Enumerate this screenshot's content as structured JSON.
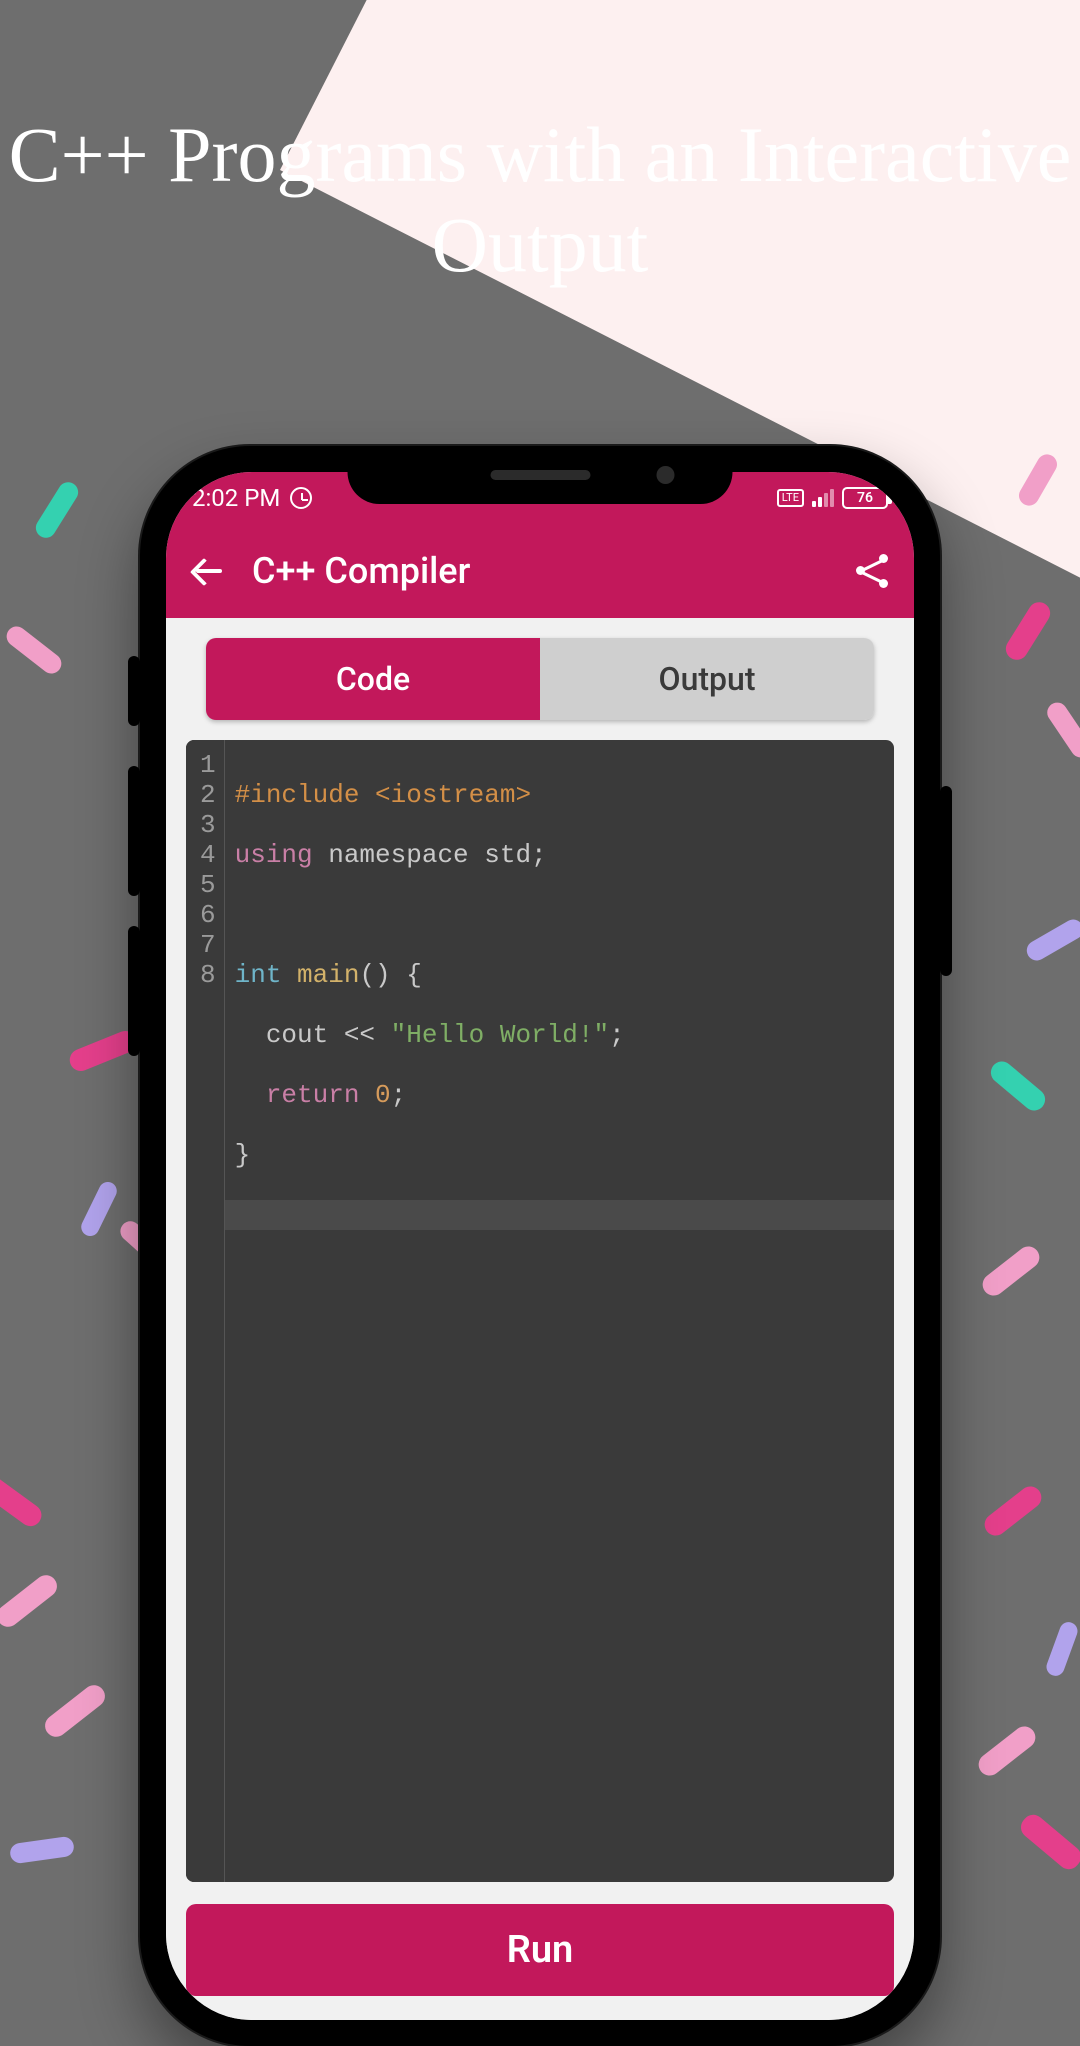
{
  "headline": "C++ Programs with an Interactive Output",
  "status": {
    "time": "2:02 PM",
    "battery_pct": "76",
    "carrier_tag": "LTE"
  },
  "appbar": {
    "title": "C++ Compiler"
  },
  "tabs": {
    "code": "Code",
    "output": "Output"
  },
  "editor": {
    "line_numbers": [
      "1",
      "2",
      "3",
      "4",
      "5",
      "6",
      "7",
      "8"
    ],
    "line1_a": "#include ",
    "line1_b": "<iostream>",
    "line2_a": "using",
    "line2_b": " namespace std;",
    "line4_a": "int",
    "line4_b": " main",
    "line4_c": "() {",
    "line5_a": "  cout << ",
    "line5_b": "\"Hello World!\"",
    "line5_c": ";",
    "line6_a": "  return ",
    "line6_b": "0",
    "line6_c": ";",
    "line7": "}"
  },
  "run_label": "Run"
}
